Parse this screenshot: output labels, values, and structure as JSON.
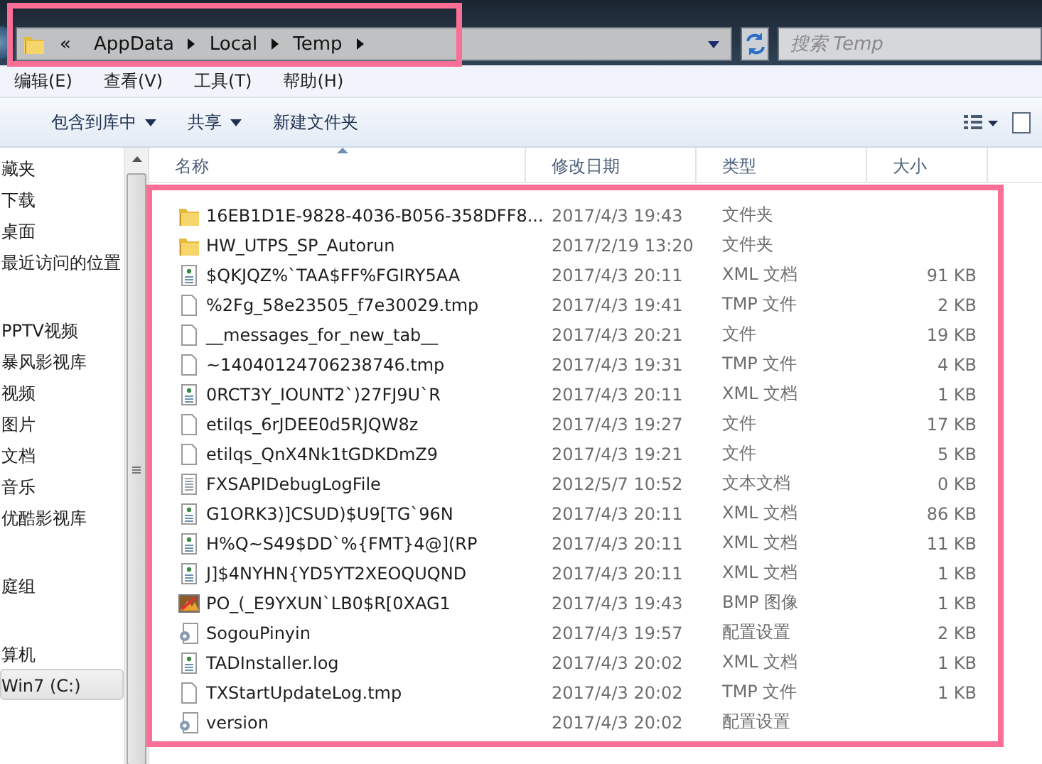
{
  "address_bar": {
    "overflow": "«",
    "path": [
      "AppData",
      "Local",
      "Temp"
    ],
    "highlighted": true
  },
  "search": {
    "placeholder": "搜索 Temp"
  },
  "menu": [
    "编辑(E)",
    "查看(V)",
    "工具(T)",
    "帮助(H)"
  ],
  "toolbar": [
    {
      "label": "包含到库中",
      "dropdown": true
    },
    {
      "label": "共享",
      "dropdown": true
    },
    {
      "label": "新建文件夹",
      "dropdown": false
    }
  ],
  "nav": [
    {
      "items": [
        {
          "label": "藏夹",
          "selected": false
        },
        {
          "label": "下载",
          "selected": false
        },
        {
          "label": "桌面",
          "selected": false
        },
        {
          "label": "最近访问的位置",
          "selected": false
        }
      ]
    },
    {
      "items": [
        {
          "label": "PPTV视频",
          "selected": false
        },
        {
          "label": "暴风影视库",
          "selected": false
        },
        {
          "label": "视频",
          "selected": false
        },
        {
          "label": "图片",
          "selected": false
        },
        {
          "label": "文档",
          "selected": false
        },
        {
          "label": "音乐",
          "selected": false
        },
        {
          "label": "优酷影视库",
          "selected": false
        }
      ]
    },
    {
      "items": [
        {
          "label": "庭组",
          "selected": false
        }
      ]
    },
    {
      "items": [
        {
          "label": "算机",
          "selected": false
        },
        {
          "label": "Win7 (C:)",
          "selected": true
        }
      ]
    }
  ],
  "columns": [
    {
      "label": "名称",
      "sorted": true
    },
    {
      "label": "修改日期",
      "sorted": false
    },
    {
      "label": "类型",
      "sorted": false
    },
    {
      "label": "大小",
      "sorted": false
    }
  ],
  "file_list": {
    "highlighted": true,
    "files": [
      {
        "kind": "folder",
        "name": "16EB1D1E-9828-4036-B056-358DFF8...",
        "modified": "2017/4/3 19:43",
        "type": "文件夹"
      },
      {
        "kind": "folder",
        "name": "HW_UTPS_SP_Autorun",
        "modified": "2017/2/19 13:20",
        "type": "文件夹"
      },
      {
        "kind": "xml",
        "name": "$QKJQZ%`TAA$FF%FGIRY5AA",
        "modified": "2017/4/3 20:11",
        "type": "XML 文档",
        "size": "91 KB"
      },
      {
        "kind": "file",
        "name": "%2Fg_58e23505_f7e30029.tmp",
        "modified": "2017/4/3 19:41",
        "type": "TMP 文件",
        "size": "2 KB"
      },
      {
        "kind": "file",
        "name": "__messages_for_new_tab__",
        "modified": "2017/4/3 20:21",
        "type": "文件",
        "size": "19 KB"
      },
      {
        "kind": "file",
        "name": "~14040124706238746.tmp",
        "modified": "2017/4/3 19:31",
        "type": "TMP 文件",
        "size": "4 KB"
      },
      {
        "kind": "xml",
        "name": "0RCT3Y_IOUNT2`)27FJ9U`R",
        "modified": "2017/4/3 20:11",
        "type": "XML 文档",
        "size": "1 KB"
      },
      {
        "kind": "file",
        "name": "etilqs_6rJDEE0d5RJQW8z",
        "modified": "2017/4/3 19:27",
        "type": "文件",
        "size": "17 KB"
      },
      {
        "kind": "file",
        "name": "etilqs_QnX4Nk1tGDKDmZ9",
        "modified": "2017/4/3 19:21",
        "type": "文件",
        "size": "5 KB"
      },
      {
        "kind": "text",
        "name": "FXSAPIDebugLogFile",
        "modified": "2012/5/7 10:52",
        "type": "文本文档",
        "size": "0 KB"
      },
      {
        "kind": "xml",
        "name": "G1ORK3)]CSUD)$U9[TG`96N",
        "modified": "2017/4/3 20:11",
        "type": "XML 文档",
        "size": "86 KB"
      },
      {
        "kind": "xml",
        "name": "H%Q~S49$DD`%{FMT}4@](RP",
        "modified": "2017/4/3 20:11",
        "type": "XML 文档",
        "size": "11 KB"
      },
      {
        "kind": "xml",
        "name": "J]$4NYHN{YD5YT2XEOQUQND",
        "modified": "2017/4/3 20:11",
        "type": "XML 文档",
        "size": "1 KB"
      },
      {
        "kind": "image",
        "name": "PO_(_E9YXUN`LB0$R[0XAG1",
        "modified": "2017/4/3 19:43",
        "type": "BMP 图像",
        "size": "1 KB"
      },
      {
        "kind": "config",
        "name": "SogouPinyin",
        "modified": "2017/4/3 19:57",
        "type": "配置设置",
        "size": "2 KB"
      },
      {
        "kind": "xml",
        "name": "TADInstaller.log",
        "modified": "2017/4/3 20:02",
        "type": "XML 文档",
        "size": "1 KB"
      },
      {
        "kind": "file",
        "name": "TXStartUpdateLog.tmp",
        "modified": "2017/4/3 20:02",
        "type": "TMP 文件",
        "size": "1 KB"
      },
      {
        "kind": "config",
        "name": "version",
        "modified": "2017/4/3 20:02",
        "type": "配置设置"
      }
    ]
  }
}
